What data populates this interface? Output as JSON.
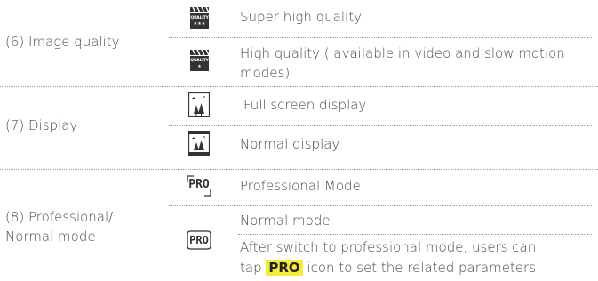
{
  "rows": {
    "image_quality": {
      "label": "(6) Image quality",
      "super_high": "Super high quality",
      "high_line1": "High quality ( available in video and slow motion",
      "high_line2": "modes)",
      "icon_super_text": "QUALITY",
      "icon_super_stars": "★★★",
      "icon_high_text": "QUALITY",
      "icon_high_stars": "★"
    },
    "display": {
      "label": "(7) Display",
      "full_screen": "Full screen display",
      "normal": "Normal display"
    },
    "professional": {
      "label_line1": "(8) Professional/",
      "label_line2": "Normal mode",
      "pro_mode": "Professional Mode",
      "normal_mode": "Normal mode",
      "note_line1": "After switch to professional mode, users can",
      "note_before": "tap ",
      "note_pro": "PRO",
      "note_after": " icon to set the related parameters.",
      "icon_pro_text": "PRO"
    }
  },
  "colors": {
    "highlight": "#f4ea3a",
    "divider": "#9a9a9a",
    "text": "#4a4a4a",
    "icon_dark": "#333333"
  }
}
